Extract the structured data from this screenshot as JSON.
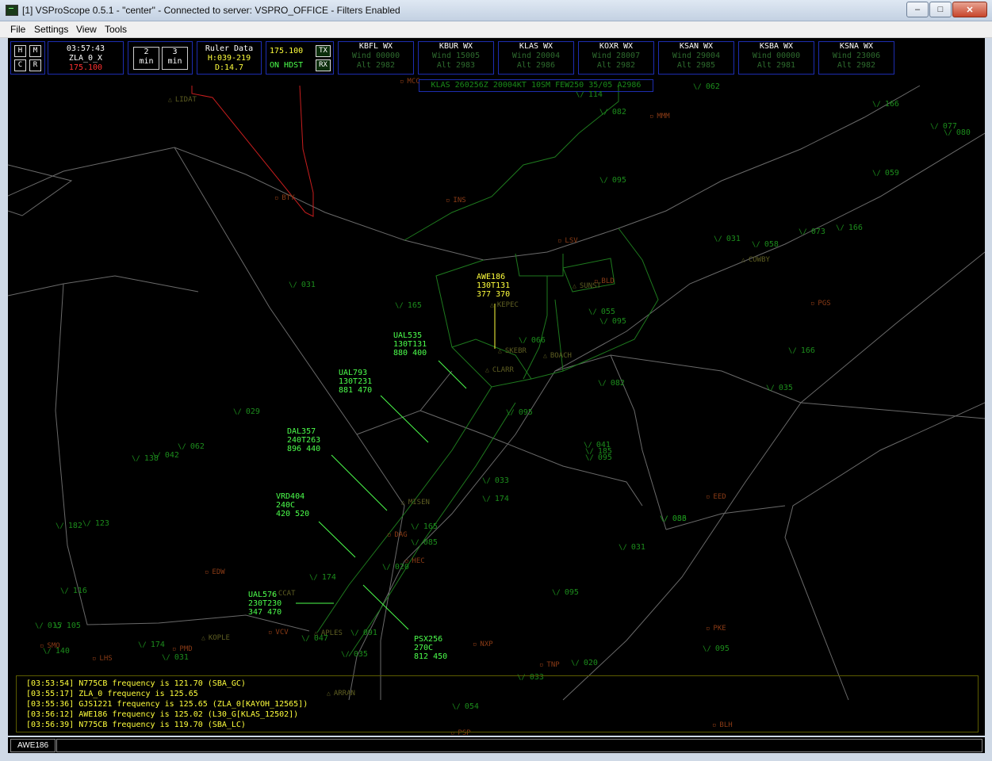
{
  "window": {
    "title": "[1] VSProScope 0.5.1 - \"center\" - Connected to server: VSPRO_OFFICE - Filters Enabled",
    "minimize": "‒",
    "maximize": "□",
    "close": "✕"
  },
  "menu": [
    "File",
    "Settings",
    "View",
    "Tools"
  ],
  "toolbar": {
    "h_label": "H",
    "m_label": "M",
    "c_label": "C",
    "r_label": "R",
    "clock": "03:57:43",
    "position": "ZLA_0_X",
    "position_freq": "175.100",
    "min2": [
      "2",
      "min"
    ],
    "min3": [
      "3",
      "min"
    ],
    "ruler_title": "Ruler Data",
    "ruler_heading": "H:039-219",
    "ruler_dist": "D:14.7",
    "freq": "175.100",
    "tx_label": "TX",
    "on_label": "ON HDST",
    "rx_label": "RX"
  },
  "weather": [
    {
      "station": "KBFL WX",
      "wind": "Wind 00000",
      "alt": "Alt 2982"
    },
    {
      "station": "KBUR WX",
      "wind": "Wind 15005",
      "alt": "Alt 2983"
    },
    {
      "station": "KLAS WX",
      "wind": "Wind 20004",
      "alt": "Alt 2986"
    },
    {
      "station": "KOXR WX",
      "wind": "Wind 28007",
      "alt": "Alt 2982"
    },
    {
      "station": "KSAN WX",
      "wind": "Wind 29004",
      "alt": "Alt 2985"
    },
    {
      "station": "KSBA WX",
      "wind": "Wind 00000",
      "alt": "Alt 2981"
    },
    {
      "station": "KSNA WX",
      "wind": "Wind 23006",
      "alt": "Alt 2982"
    }
  ],
  "metar": "KLAS 260256Z 20004KT 10SM FEW250 35/05 A2986",
  "fixes": [
    "LIDAT",
    "KEPEC",
    "SKEBR",
    "BOACH",
    "CLARR",
    "COWBY",
    "MISEN",
    "CCAT",
    "KOPLE",
    "APLES",
    "SUNST",
    "ARRAN"
  ],
  "airports": [
    "MCC",
    "BTY",
    "INS",
    "MMM",
    "LSV",
    "BLD",
    "PGS",
    "EED",
    "DAG",
    "HEC",
    "EDW",
    "PMD",
    "LHS",
    "VCV",
    "NXP",
    "TNP",
    "PKE",
    "BLH",
    "PSP",
    "SMO"
  ],
  "altitudes": [
    "114",
    "062",
    "082",
    "166",
    "077",
    "080",
    "095",
    "059",
    "031",
    "058",
    "073",
    "166",
    "165",
    "031",
    "055",
    "095",
    "066",
    "166",
    "082",
    "095",
    "035",
    "029",
    "041",
    "185",
    "095",
    "138",
    "042",
    "062",
    "033",
    "174",
    "033",
    "165",
    "085",
    "086",
    "182",
    "123",
    "020",
    "031",
    "174",
    "116",
    "095",
    "015",
    "105",
    "091",
    "047",
    "035",
    "140",
    "174",
    "031",
    "020",
    "033",
    "054",
    "095"
  ],
  "aircraft": [
    {
      "call": "AWE186",
      "line2": "130T131",
      "line3": "377 370",
      "selected": true
    },
    {
      "call": "UAL535",
      "line2": "130T131",
      "line3": "880 400",
      "selected": false
    },
    {
      "call": "UAL793",
      "line2": "130T231",
      "line3": "881 470",
      "selected": false
    },
    {
      "call": "DAL357",
      "line2": "240T263",
      "line3": "896 440",
      "selected": false
    },
    {
      "call": "VRD404",
      "line2": "240C",
      "line3": "420 520",
      "selected": false
    },
    {
      "call": "UAL576",
      "line2": "230T230",
      "line3": "347 470",
      "selected": false
    },
    {
      "call": "PSX256",
      "line2": "270C",
      "line3": "812 450",
      "selected": false
    }
  ],
  "messages": [
    "[03:53:54] N775CB frequency is 121.70 (SBA_GC)",
    "[03:55:17] ZLA_0 frequency is 125.65",
    "[03:55:36] GJS1221 frequency is 125.65 (ZLA_0[KAYOH_12565])",
    "[03:56:12] AWE186 frequency is 125.02 (L30_G[KLAS_12502])",
    "[03:56:39] N775CB frequency is 119.70 (SBA_LC)"
  ],
  "status": {
    "callsign": "AWE186",
    "command": ""
  },
  "colors": {
    "background": "#000000",
    "aircraft": "#4cff4c",
    "selected": "#ffff3c",
    "boundary": "#8a8a8a",
    "approach": "#1e7a1e",
    "restricted": "#c81e1e"
  }
}
